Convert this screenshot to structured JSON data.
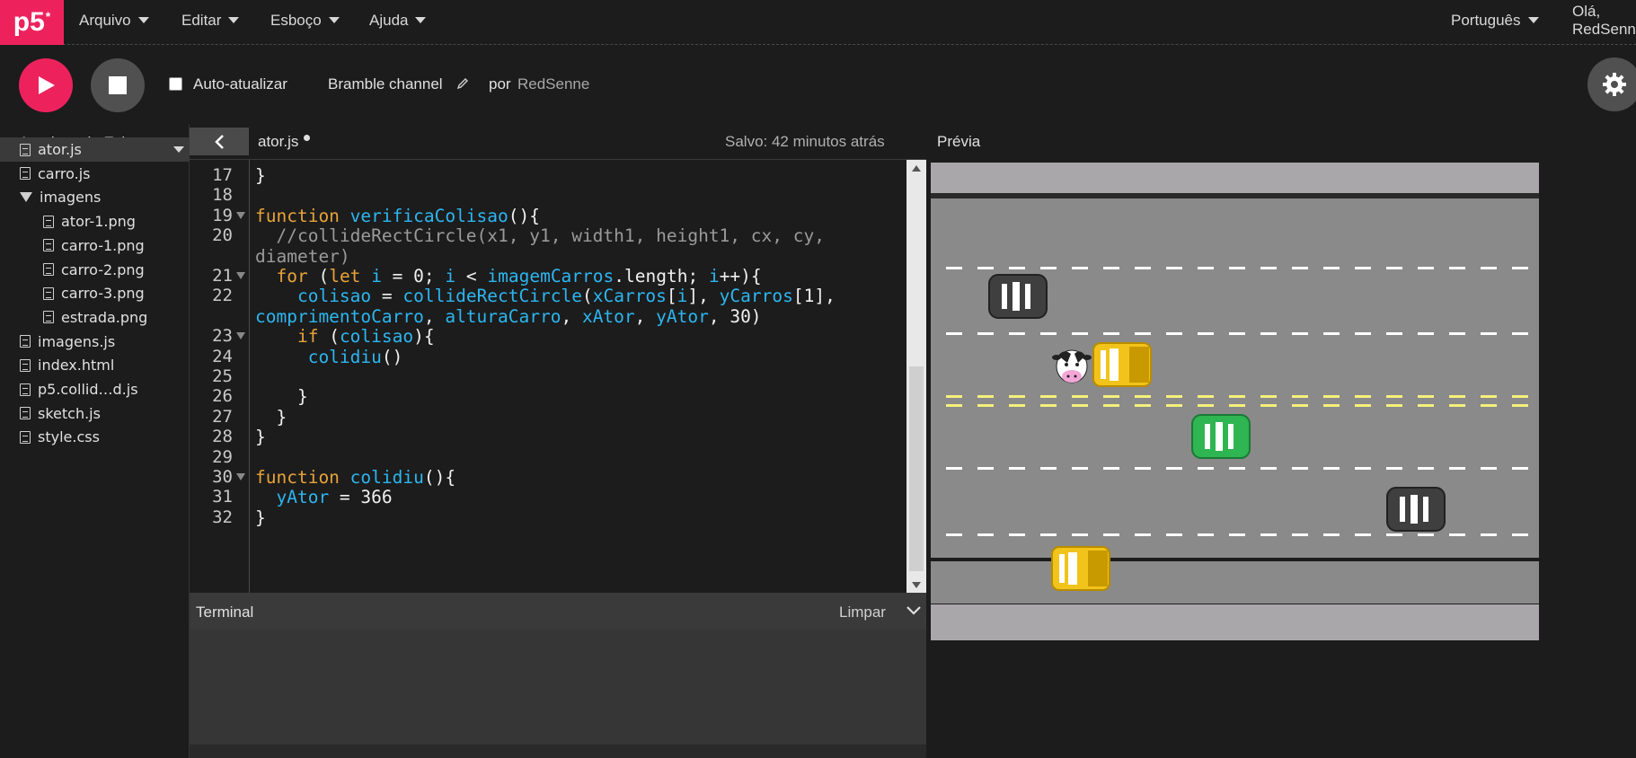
{
  "logo": {
    "text": "p5",
    "star": "*"
  },
  "menu": {
    "file": "Arquivo",
    "edit": "Editar",
    "sketch": "Esboço",
    "help": "Ajuda",
    "language": "Português",
    "user": "Olá, RedSenne!"
  },
  "toolbar": {
    "auto_refresh": "Auto-atualizar",
    "auto_refresh_checked": false,
    "sketch_name": "Bramble channel",
    "by": "por",
    "author": "RedSenne"
  },
  "sidebar": {
    "title": "Arquivos do Esboço",
    "files": [
      {
        "name": "ator.js",
        "type": "file",
        "level": 0,
        "selected": true
      },
      {
        "name": "carro.js",
        "type": "file",
        "level": 0
      },
      {
        "name": "imagens",
        "type": "folder",
        "level": 0
      },
      {
        "name": "ator-1.png",
        "type": "file",
        "level": 1
      },
      {
        "name": "carro-1.png",
        "type": "file",
        "level": 1
      },
      {
        "name": "carro-2.png",
        "type": "file",
        "level": 1
      },
      {
        "name": "carro-3.png",
        "type": "file",
        "level": 1
      },
      {
        "name": "estrada.png",
        "type": "file",
        "level": 1
      },
      {
        "name": "imagens.js",
        "type": "file",
        "level": 0
      },
      {
        "name": "index.html",
        "type": "file",
        "level": 0
      },
      {
        "name": "p5.collid…d.js",
        "type": "file",
        "level": 0
      },
      {
        "name": "sketch.js",
        "type": "file",
        "level": 0
      },
      {
        "name": "style.css",
        "type": "file",
        "level": 0
      }
    ]
  },
  "editor": {
    "tab": "ator.js",
    "saved": "Salvo: 42 minutos atrás",
    "line_numbers": [
      "17",
      "18",
      "19",
      "20",
      "21",
      "22",
      "23",
      "24",
      "25",
      "26",
      "27",
      "28",
      "29",
      "30",
      "31",
      "32"
    ],
    "lines": [
      "}",
      "",
      "function verificaColisao(){",
      "  //collideRectCircle(x1, y1, width1, height1, cx, cy,",
      "diameter)",
      "  for (let i = 0; i < imagemCarros.length; i++){",
      "    colisao = collideRectCircle(xCarros[i], yCarros[1],",
      "comprimentoCarro, alturaCarro, xAtor, yAtor, 30)",
      "    if (colisao){",
      "     colidiu()",
      "",
      "    }",
      "  }",
      "}",
      "",
      "function colidiu(){",
      "  yAtor = 366",
      "}"
    ]
  },
  "console": {
    "title": "Terminal",
    "clear": "Limpar"
  },
  "preview": {
    "title": "Prévia"
  },
  "colors": {
    "accent": "#ed225d",
    "keyword": "#e8a33a",
    "function": "#2cb6f0",
    "comment": "#9a9a9a"
  }
}
